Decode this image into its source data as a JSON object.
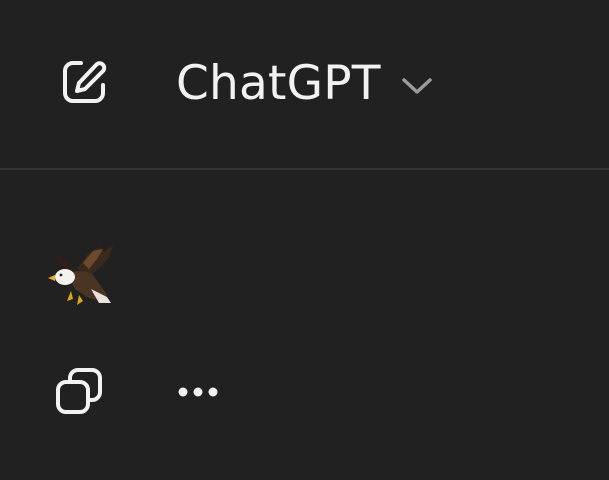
{
  "header": {
    "new_chat_icon": "edit-icon",
    "model_name": "ChatGPT",
    "model_chevron_icon": "chevron-down-icon"
  },
  "gpt_avatar": {
    "icon": "eagle-avatar-icon"
  },
  "toolbar": {
    "copy_icon": "copy-icon",
    "more_icon": "ellipsis-icon"
  },
  "colors": {
    "background": "#212121",
    "divider": "#363636",
    "text": "#f2f2f2",
    "chevron": "#9b9b9b"
  }
}
